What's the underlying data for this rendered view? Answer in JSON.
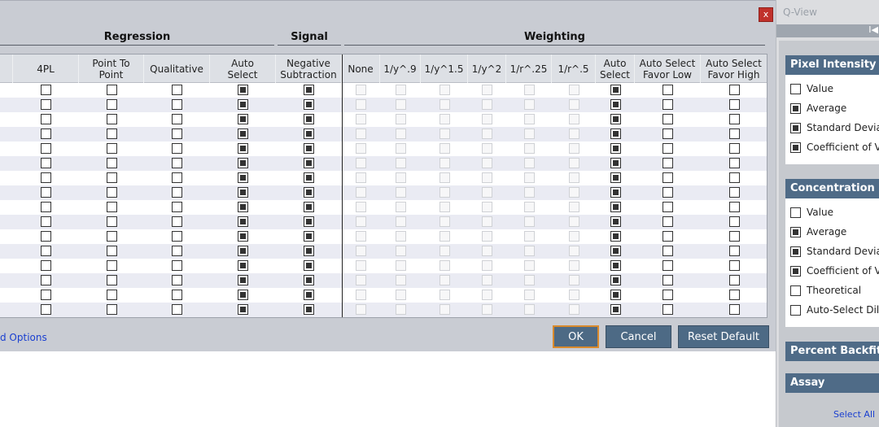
{
  "dialog": {
    "close_label": "x",
    "groups": {
      "regression": "Regression",
      "signal": "Signal",
      "weighting": "Weighting"
    },
    "columns": [
      {
        "key": "4pl",
        "label": "4PL"
      },
      {
        "key": "p2p",
        "label": "Point To\nPoint"
      },
      {
        "key": "qual",
        "label": "Qualitative"
      },
      {
        "key": "reg_auto",
        "label": "Auto\nSelect"
      },
      {
        "key": "neg_sub",
        "label": "Negative\nSubtraction"
      },
      {
        "key": "none",
        "label": "None"
      },
      {
        "key": "y9",
        "label": "1/y^.9"
      },
      {
        "key": "y15",
        "label": "1/y^1.5"
      },
      {
        "key": "y2",
        "label": "1/y^2"
      },
      {
        "key": "r25",
        "label": "1/r^.25"
      },
      {
        "key": "r5",
        "label": "1/r^.5"
      },
      {
        "key": "w_auto",
        "label": "Auto\nSelect"
      },
      {
        "key": "w_low",
        "label": "Auto Select\nFavor Low"
      },
      {
        "key": "w_high",
        "label": "Auto Select\nFavor High"
      }
    ],
    "row_count": 16,
    "row_state": {
      "4pl": false,
      "p2p": false,
      "qual": false,
      "reg_auto": true,
      "neg_sub": true,
      "none": false,
      "y9": false,
      "y15": false,
      "y2": false,
      "r25": false,
      "r5": false,
      "w_auto": true,
      "w_low": false,
      "w_high": false
    },
    "disabled_columns": [
      "none",
      "y9",
      "y15",
      "y2",
      "r25",
      "r5"
    ],
    "advanced_link": "d Options",
    "buttons": {
      "ok": "OK",
      "cancel": "Cancel",
      "reset": "Reset Default"
    }
  },
  "qview": {
    "title": "Q-View",
    "top_glyph": "I◀",
    "sections": [
      {
        "title": "Pixel Intensity",
        "items": [
          {
            "label": "Value",
            "checked": false
          },
          {
            "label": "Average",
            "checked": true
          },
          {
            "label": "Standard Deviation",
            "checked": true
          },
          {
            "label": "Coefficient of Variation",
            "checked": true
          }
        ]
      },
      {
        "title": "Concentration",
        "items": [
          {
            "label": "Value",
            "checked": false
          },
          {
            "label": "Average",
            "checked": true
          },
          {
            "label": "Standard Deviation",
            "checked": true
          },
          {
            "label": "Coefficient of Variation",
            "checked": true
          },
          {
            "label": "Theoretical",
            "checked": false
          },
          {
            "label": "Auto-Select Dilution",
            "checked": false
          }
        ]
      },
      {
        "title": "Percent Backfit",
        "items": []
      },
      {
        "title": "Assay",
        "items": []
      }
    ],
    "select_all": "Select All"
  }
}
